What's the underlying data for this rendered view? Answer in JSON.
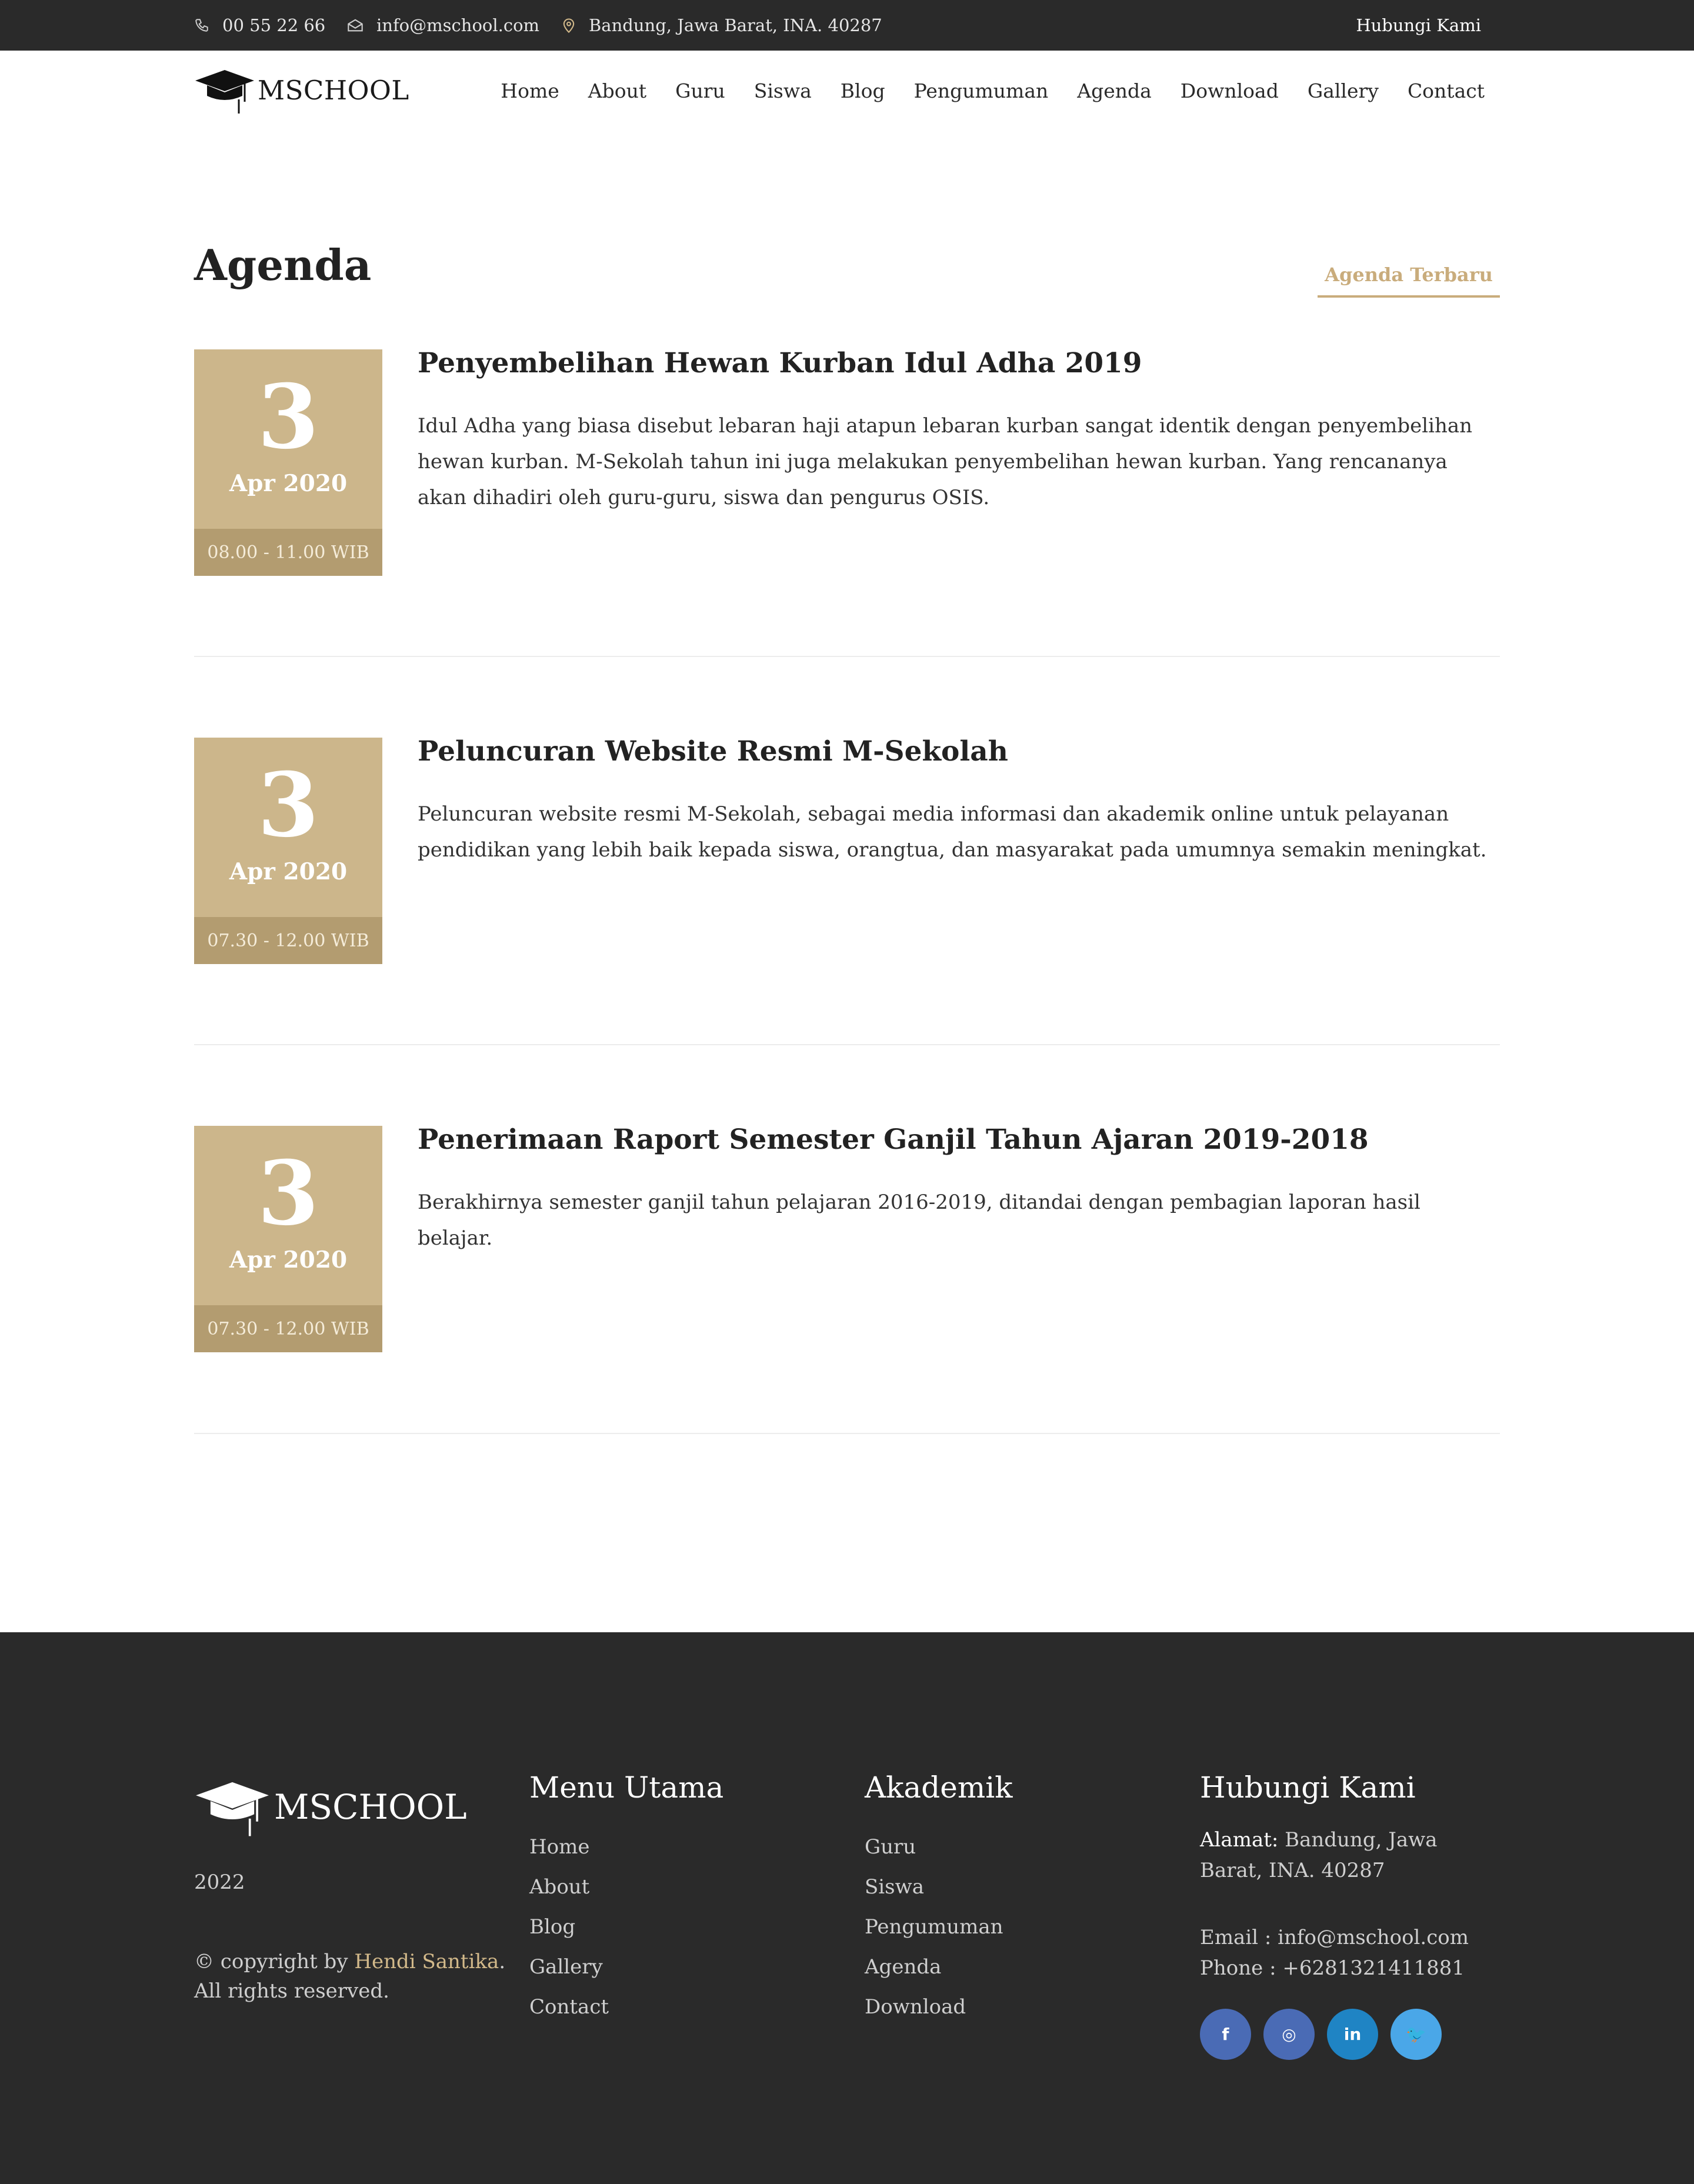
{
  "topbar": {
    "phone": "00 55 22 66",
    "email": "info@mschool.com",
    "address": "Bandung, Jawa Barat, INA. 40287",
    "cta": "Hubungi Kami"
  },
  "brand": {
    "name": "MSCHOOL",
    "accent": "#c9ac7c",
    "dark": "#2a2a2a"
  },
  "nav": [
    "Home",
    "About",
    "Guru",
    "Siswa",
    "Blog",
    "Pengumuman",
    "Agenda",
    "Download",
    "Gallery",
    "Contact"
  ],
  "page": {
    "title": "Agenda",
    "tab": "Agenda Terbaru"
  },
  "agenda": [
    {
      "day": "3",
      "month_year": "Apr 2020",
      "time": "08.00 - 11.00 WIB",
      "title": "Penyembelihan Hewan Kurban Idul Adha 2019",
      "desc": "Idul Adha yang biasa disebut lebaran haji atapun lebaran kurban sangat identik dengan penyembelihan hewan kurban. M-Sekolah tahun ini juga melakukan penyembelihan hewan kurban. Yang rencananya akan dihadiri oleh guru-guru, siswa dan pengurus OSIS."
    },
    {
      "day": "3",
      "month_year": "Apr 2020",
      "time": "07.30 - 12.00 WIB",
      "title": "Peluncuran Website Resmi M-Sekolah",
      "desc": "Peluncuran website resmi M-Sekolah, sebagai media informasi dan akademik online untuk pelayanan pendidikan yang lebih baik kepada siswa, orangtua, dan masyarakat pada umumnya semakin meningkat."
    },
    {
      "day": "3",
      "month_year": "Apr 2020",
      "time": "07.30 - 12.00 WIB",
      "title": "Penerimaan Raport Semester Ganjil Tahun Ajaran 2019-2018",
      "desc": "Berakhirnya semester ganjil tahun pelajaran 2016-2019, ditandai dengan pembagian laporan hasil belajar."
    }
  ],
  "footer": {
    "brand": "MSCHOOL",
    "year": "2022",
    "copyright_prefix": "© copyright by ",
    "copyright_author": "Hendi Santika",
    "copyright_suffix": ".",
    "rights": "All rights reserved.",
    "menu_title": "Menu Utama",
    "menu": [
      "Home",
      "About",
      "Blog",
      "Gallery",
      "Contact"
    ],
    "akademik_title": "Akademik",
    "akademik": [
      "Guru",
      "Siswa",
      "Pengumuman",
      "Agenda",
      "Download"
    ],
    "contact_title": "Hubungi Kami",
    "address_label": "Alamat:",
    "address": " Bandung, Jawa Barat, INA. 40287",
    "email_line": "Email : info@mschool.com",
    "phone_line": "Phone : +6281321411881",
    "socials": [
      {
        "icon": "facebook-icon",
        "glyph": "f",
        "color": "#4a6bb5"
      },
      {
        "icon": "instagram-icon",
        "glyph": "◎",
        "color": "#4a6bb5"
      },
      {
        "icon": "linkedin-icon",
        "glyph": "in",
        "color": "#1f84c4"
      },
      {
        "icon": "twitter-icon",
        "glyph": "🐦",
        "color": "#4aa7e8"
      }
    ]
  }
}
